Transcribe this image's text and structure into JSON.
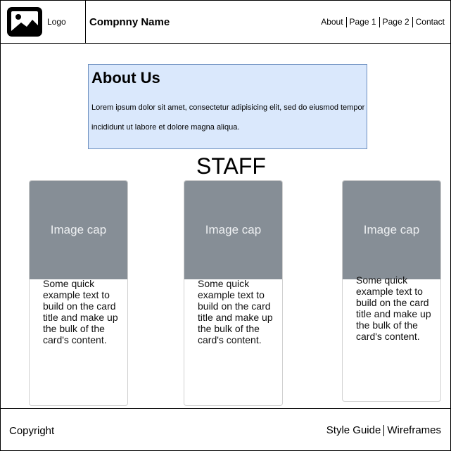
{
  "header": {
    "logo_label": "Logo",
    "company_name": "Compnny Name",
    "nav": [
      "About",
      "Page 1",
      "Page 2",
      "Contact"
    ]
  },
  "about": {
    "title": "About Us",
    "text": "Lorem ipsum dolor sit amet, consectetur adipisicing elit, sed do eiusmod tempor incididunt ut labore et dolore magna aliqua."
  },
  "staff_heading": "STAFF",
  "cards": [
    {
      "cap": "Image cap",
      "text": "Some quick example text to build on the card title and make up the bulk of the card's content."
    },
    {
      "cap": "Image cap",
      "text": "Some quick example text to build on the card title and make up the bulk of the card's content."
    },
    {
      "cap": "Image cap",
      "text": "Some quick example text to build on the card title and make up the bulk of the card's content."
    }
  ],
  "footer": {
    "copyright": "Copyright",
    "links": [
      "Style Guide",
      "Wireframes"
    ]
  },
  "colors": {
    "about_bg": "#dae8fc",
    "about_border": "#6c8ebf",
    "image_cap_bg": "#868e96"
  },
  "icons": {
    "logo": "image-icon"
  }
}
